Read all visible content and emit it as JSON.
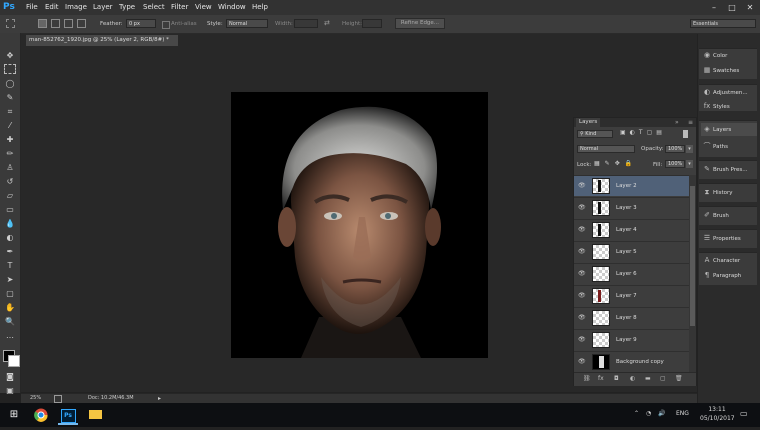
{
  "app": {
    "logo": "Ps"
  },
  "menu": [
    "File",
    "Edit",
    "Image",
    "Layer",
    "Type",
    "Select",
    "Filter",
    "View",
    "Window",
    "Help"
  ],
  "window_controls": {
    "minimize": "–",
    "maximize": "□",
    "close": "✕"
  },
  "options": {
    "feather_label": "Feather:",
    "feather_value": "0 px",
    "antialias_label": "Anti-alias",
    "style_label": "Style:",
    "style_value": "Normal",
    "width_label": "Width:",
    "height_label": "Height:",
    "refine_edge": "Refine Edge...",
    "workspace": "Essentials"
  },
  "document": {
    "tab_title": "man-852762_1920.jpg @ 25% (Layer 2, RGB/8#) *",
    "zoom": "25%",
    "doc_size": "Doc: 10.2M/46.3M"
  },
  "right_panels": {
    "group1": [
      "Color",
      "Swatches"
    ],
    "group2": [
      "Adjustmen...",
      "Styles"
    ],
    "group3": [
      "Layers",
      "Paths"
    ],
    "group4": [
      "Brush Pres..."
    ],
    "group5": [
      "History"
    ],
    "group6": [
      "Brush"
    ],
    "group7": [
      "Properties"
    ],
    "group8": [
      "Character",
      "Paragraph"
    ]
  },
  "layers_panel": {
    "tab": "Layers",
    "filter": "Kind",
    "blend_mode": "Normal",
    "opacity_label": "Opacity:",
    "opacity_value": "100%",
    "lock_label": "Lock:",
    "fill_label": "Fill:",
    "fill_value": "100%",
    "layers": [
      {
        "name": "Layer 2",
        "selected": true
      },
      {
        "name": "Layer 3",
        "selected": false
      },
      {
        "name": "Layer 4",
        "selected": false
      },
      {
        "name": "Layer 5",
        "selected": false
      },
      {
        "name": "Layer 6",
        "selected": false
      },
      {
        "name": "Layer 7",
        "selected": false
      },
      {
        "name": "Layer 8",
        "selected": false
      },
      {
        "name": "Layer 9",
        "selected": false
      },
      {
        "name": "Background copy",
        "selected": false
      }
    ]
  },
  "taskbar": {
    "language": "ENG",
    "time": "13:11",
    "date": "05/10/2017"
  },
  "colors": {
    "selected_layer": "#506178",
    "ps_blue": "#31a8ff"
  }
}
